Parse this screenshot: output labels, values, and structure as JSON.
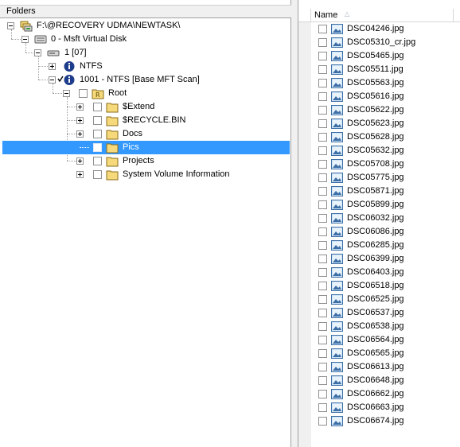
{
  "left_pane": {
    "header": "Folders"
  },
  "tree": {
    "drive": "F:\\@RECOVERY UDMA\\NEWTASK\\",
    "disk": "0 - Msft Virtual Disk",
    "partition": "1 [07]",
    "ntfs": "NTFS",
    "scan": "1001 - NTFS [Base MFT Scan]",
    "root": "Root",
    "folders": [
      {
        "label": "$Extend"
      },
      {
        "label": "$RECYCLE.BIN"
      },
      {
        "label": "Docs"
      },
      {
        "label": "Pics",
        "selected": true
      },
      {
        "label": "Projects"
      },
      {
        "label": "System Volume Information"
      }
    ]
  },
  "list": {
    "column_name": "Name",
    "sort_arrow": "△",
    "files": [
      "DSC04246.jpg",
      "DSC05310_cr.jpg",
      "DSC05465.jpg",
      "DSC05511.jpg",
      "DSC05563.jpg",
      "DSC05616.jpg",
      "DSC05622.jpg",
      "DSC05623.jpg",
      "DSC05628.jpg",
      "DSC05632.jpg",
      "DSC05708.jpg",
      "DSC05775.jpg",
      "DSC05871.jpg",
      "DSC05899.jpg",
      "DSC06032.jpg",
      "DSC06086.jpg",
      "DSC06285.jpg",
      "DSC06399.jpg",
      "DSC06403.jpg",
      "DSC06518.jpg",
      "DSC06525.jpg",
      "DSC06537.jpg",
      "DSC06538.jpg",
      "DSC06564.jpg",
      "DSC06565.jpg",
      "DSC06613.jpg",
      "DSC06648.jpg",
      "DSC06662.jpg",
      "DSC06663.jpg",
      "DSC06674.jpg"
    ]
  },
  "icons": {
    "folder": "folder-icon",
    "drive": "recovery-drive-icon",
    "disk": "disk-icon",
    "partition": "partition-icon",
    "info": "info-icon",
    "image_file": "image-file-icon"
  },
  "colors": {
    "selection": "#3399ff",
    "folder": "#f5d97a",
    "info": "#1e3c8c"
  }
}
